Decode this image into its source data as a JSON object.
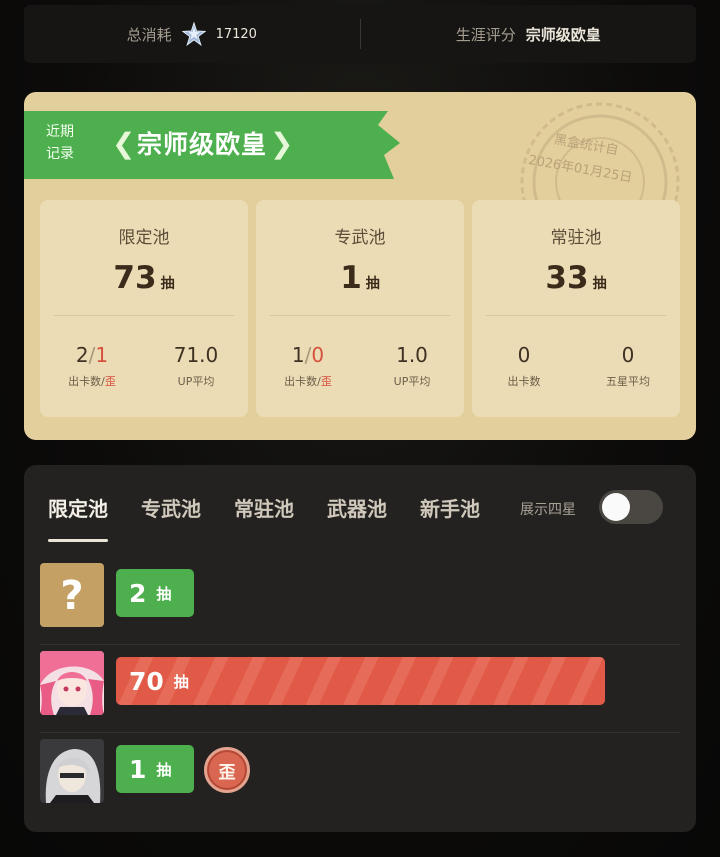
{
  "summary": {
    "total_label": "总消耗",
    "total_icon": "crystal-star-icon",
    "total_value": "17120",
    "rating_label": "生涯评分",
    "rating_value": "宗师级欧皇"
  },
  "recent": {
    "label_line1": "近期",
    "label_line2": "记录",
    "title": "宗师级欧皇",
    "stamp_line1": "黑盒统计自",
    "stamp_line2": "2026年01月25日",
    "pools": [
      {
        "name": "限定池",
        "count": "73",
        "unit": "抽",
        "left_value_a": "2",
        "left_value_sep": "/",
        "left_value_b": "1",
        "left_caption_a": "出卡数/",
        "left_caption_b": "歪",
        "right_value": "71.0",
        "right_caption": "UP平均"
      },
      {
        "name": "专武池",
        "count": "1",
        "unit": "抽",
        "left_value_a": "1",
        "left_value_sep": "/",
        "left_value_b": "0",
        "left_caption_a": "出卡数/",
        "left_caption_b": "歪",
        "right_value": "1.0",
        "right_caption": "UP平均"
      },
      {
        "name": "常驻池",
        "count": "33",
        "unit": "抽",
        "left_value": "0",
        "left_caption": "出卡数",
        "right_value": "0",
        "right_caption": "五星平均"
      }
    ]
  },
  "history": {
    "tabs": [
      "限定池",
      "专武池",
      "常驻池",
      "武器池",
      "新手池"
    ],
    "active_tab": 0,
    "toggle_label": "展示四星",
    "toggle_on": false,
    "rows": [
      {
        "avatar": "unknown-question-icon",
        "pulls": "2",
        "unit": "抽",
        "progress": 0.03,
        "color": "green",
        "off_banner": false
      },
      {
        "avatar": "pink-hair-character-avatar",
        "pulls": "70",
        "unit": "抽",
        "progress": 0.97,
        "color": "red",
        "off_banner": false
      },
      {
        "avatar": "white-hair-character-avatar",
        "pulls": "1",
        "unit": "抽",
        "progress": 0.01,
        "color": "green",
        "off_banner": true,
        "badge": "歪"
      }
    ]
  },
  "colors": {
    "accent_green": "#4daf4d",
    "accent_red": "#e05a47",
    "card_bg": "#e3cf9b"
  }
}
